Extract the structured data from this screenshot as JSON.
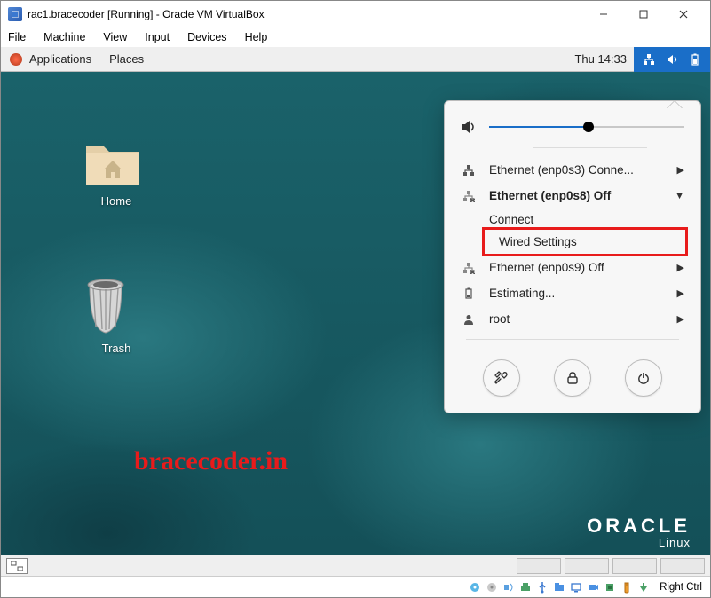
{
  "titlebar": {
    "title": "rac1.bracecoder [Running] - Oracle VM VirtualBox"
  },
  "menubar": {
    "file": "File",
    "machine": "Machine",
    "view": "View",
    "input": "Input",
    "devices": "Devices",
    "help": "Help"
  },
  "gnome_top": {
    "applications": "Applications",
    "places": "Places",
    "clock": "Thu 14:33"
  },
  "desktop": {
    "home_label": "Home",
    "trash_label": "Trash"
  },
  "watermark": "bracecoder.in",
  "oracle": {
    "brand": "ORACLE",
    "sub": "Linux"
  },
  "popover": {
    "volume_pct": 50,
    "item1": "Ethernet (enp0s3) Conne...",
    "item2": "Ethernet (enp0s8) Off",
    "item2_connect": "Connect",
    "item2_wired": "Wired Settings",
    "item3": "Ethernet (enp0s9) Off",
    "item4": "Estimating...",
    "item5": "root"
  },
  "vbox_status": {
    "host_key": "Right Ctrl"
  }
}
